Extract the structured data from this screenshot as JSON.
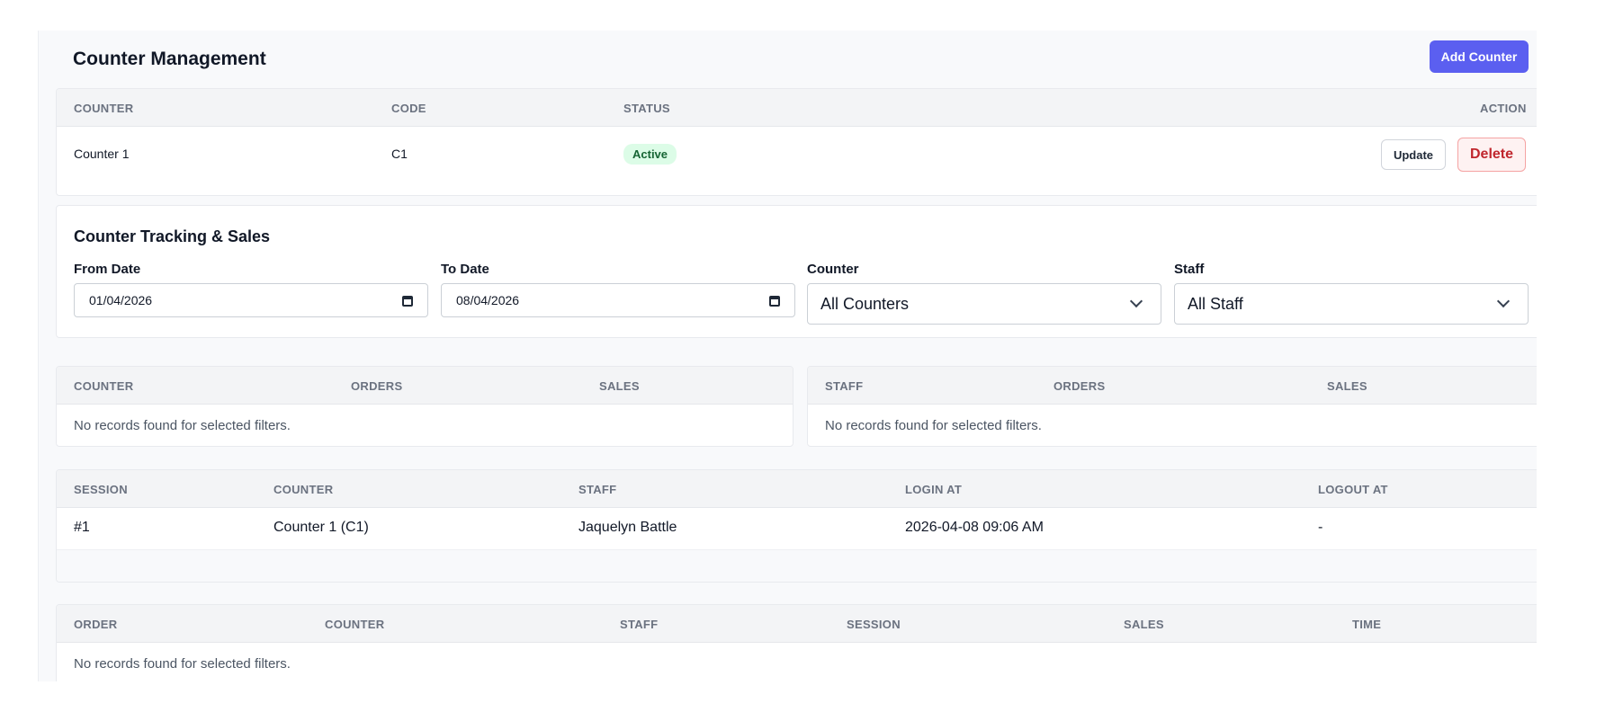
{
  "management": {
    "title": "Counter Management",
    "add_button": "Add Counter",
    "columns": [
      "COUNTER",
      "CODE",
      "STATUS",
      "ACTION"
    ],
    "rows": [
      {
        "counter": "Counter 1",
        "code": "C1",
        "status": "Active",
        "update": "Update",
        "delete": "Delete"
      }
    ]
  },
  "tracking": {
    "title": "Counter Tracking & Sales",
    "from_label": "From Date",
    "from_value": "01/04/2026",
    "to_label": "To Date",
    "to_value": "08/04/2026",
    "counter_label": "Counter",
    "counter_value": "All Counters",
    "staff_label": "Staff",
    "staff_value": "All Staff"
  },
  "counter_sales": {
    "columns": [
      "COUNTER",
      "ORDERS",
      "SALES"
    ],
    "empty": "No records found for selected filters."
  },
  "staff_sales": {
    "columns": [
      "STAFF",
      "ORDERS",
      "SALES"
    ],
    "empty": "No records found for selected filters."
  },
  "sessions": {
    "columns": [
      "SESSION",
      "COUNTER",
      "STAFF",
      "LOGIN AT",
      "LOGOUT AT"
    ],
    "rows": [
      {
        "session": "#1",
        "counter": "Counter 1 (C1)",
        "staff": "Jaquelyn Battle",
        "login": "2026-04-08 09:06 AM",
        "logout": "-"
      }
    ]
  },
  "orders": {
    "columns": [
      "ORDER",
      "COUNTER",
      "STAFF",
      "SESSION",
      "SALES",
      "TIME"
    ],
    "empty": "No records found for selected filters."
  },
  "colors": {
    "accent": "#5b5ff0",
    "active_badge": "#dcfce7",
    "delete": "#c0262d"
  }
}
